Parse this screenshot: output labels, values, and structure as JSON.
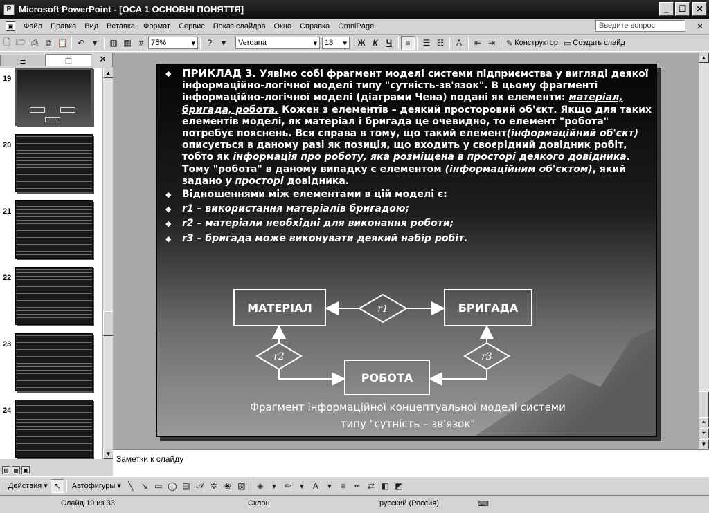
{
  "window": {
    "title": "Microsoft PowerPoint - [ОСА 1 ОСНОВНІ ПОНЯТТЯ]",
    "minimize": "_",
    "maximize": "❐",
    "close": "✕"
  },
  "menu": {
    "items": [
      "Файл",
      "Правка",
      "Вид",
      "Вставка",
      "Формат",
      "Сервис",
      "Показ слайдов",
      "Окно",
      "Справка",
      "OmniPage"
    ],
    "ask_placeholder": "Введите вопрос",
    "doc_close": "✕"
  },
  "toolbar": {
    "zoom": "75%",
    "font": "Verdana",
    "font_size": "18",
    "bold": "Ж",
    "italic": "К",
    "underline": "Ч",
    "designer": "Конструктор",
    "new_slide": "Создать слайд"
  },
  "left_pane": {
    "tab_outline": "≣",
    "tab_slides": "▢",
    "close": "✕",
    "thumbnails": [
      "19",
      "20",
      "21",
      "22",
      "23",
      "24"
    ],
    "selected": "19"
  },
  "slide": {
    "p1_lead": "ПРИКЛАД 3.",
    "p1_a": " Уявімо собі фрагмент моделі системи підприємства у вигляді деякої інформаційно-логічної моделі типу \"сутність-зв'язок\".  В цьому фрагменті інформаційно-логічної моделі (діаграми Чена) подані як елементи: ",
    "p1_elements": "матеріал, бригада, робота.",
    "p1_b": " Кожен з елементів – деякий просторовий об'єкт. Якщо для таких елементів моделі, як матеріал і бригада це  очевидно, то елемент \"робота\" потребує пояснень. Вся справа в тому, що такий елемент",
    "p1_c": "(інформаційний об'єкт)",
    "p1_d": " описується в даному разі як позиція, що входить  у своєрідний довідник робіт, тобто як ",
    "p1_e": "інформація про роботу, яка розміщена в просторі деякого довідника",
    "p1_f": ". Тому \"робота\" в даному випадку є елементом ",
    "p1_g": "(інформаційним об'єктом)",
    "p1_h": ", який задано ",
    "p1_i": "у просторі",
    "p1_j": " довідника.",
    "p2": "Відношеннями між елементами в цій моделі є:",
    "r1": " r1  –  використання матеріалів бригадою;",
    "r2": "r2  –  матеріали необхідні для виконання роботи;",
    "r3": "r3  –  бригада може виконувати деякий набір робіт.",
    "bullet_mark": "◆",
    "entity_material": "МАТЕРІАЛ",
    "entity_brigade": "БРИГАДА",
    "entity_work": "РОБОТА",
    "rel_r1": "r1",
    "rel_r2": "r2",
    "rel_r3": "r3",
    "caption_line1": "Фрагмент інформаційної концептуальної моделі системи",
    "caption_line2": "типу \"сутність – зв'язок\""
  },
  "notes": {
    "placeholder": "Заметки к слайду"
  },
  "drawing": {
    "actions": "Действия",
    "autoshapes": "Автофигуры"
  },
  "status": {
    "slide": "Слайд 19 из 33",
    "design": "Склон",
    "language": "русский (Россия)"
  }
}
